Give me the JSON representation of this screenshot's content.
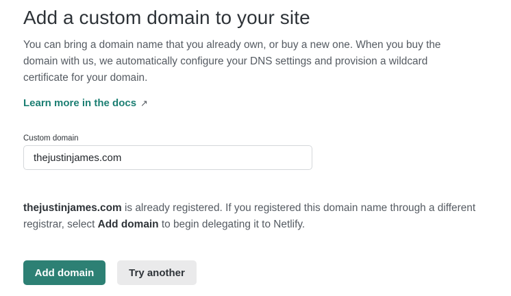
{
  "header": {
    "title": "Add a custom domain to your site"
  },
  "intro": {
    "description": "You can bring a domain name that you already own, or buy a new one. When you buy the domain with us, we automatically configure your DNS settings and provision a wildcard certificate for your domain.",
    "docs_link_label": "Learn more in the docs",
    "docs_link_icon": "external-arrow-icon"
  },
  "form": {
    "field_label": "Custom domain",
    "field_value": "thejustinjames.com"
  },
  "notice": {
    "domain": "thejustinjames.com",
    "text_1": " is already registered. If you registered this domain name through a different registrar, select ",
    "action_name": "Add domain",
    "text_2": " to begin delegating it to Netlify."
  },
  "actions": {
    "primary_label": "Add domain",
    "secondary_label": "Try another"
  },
  "colors": {
    "accent": "#2d8074",
    "link": "#1b7e72",
    "secondary_button_bg": "#eaeaeb"
  }
}
